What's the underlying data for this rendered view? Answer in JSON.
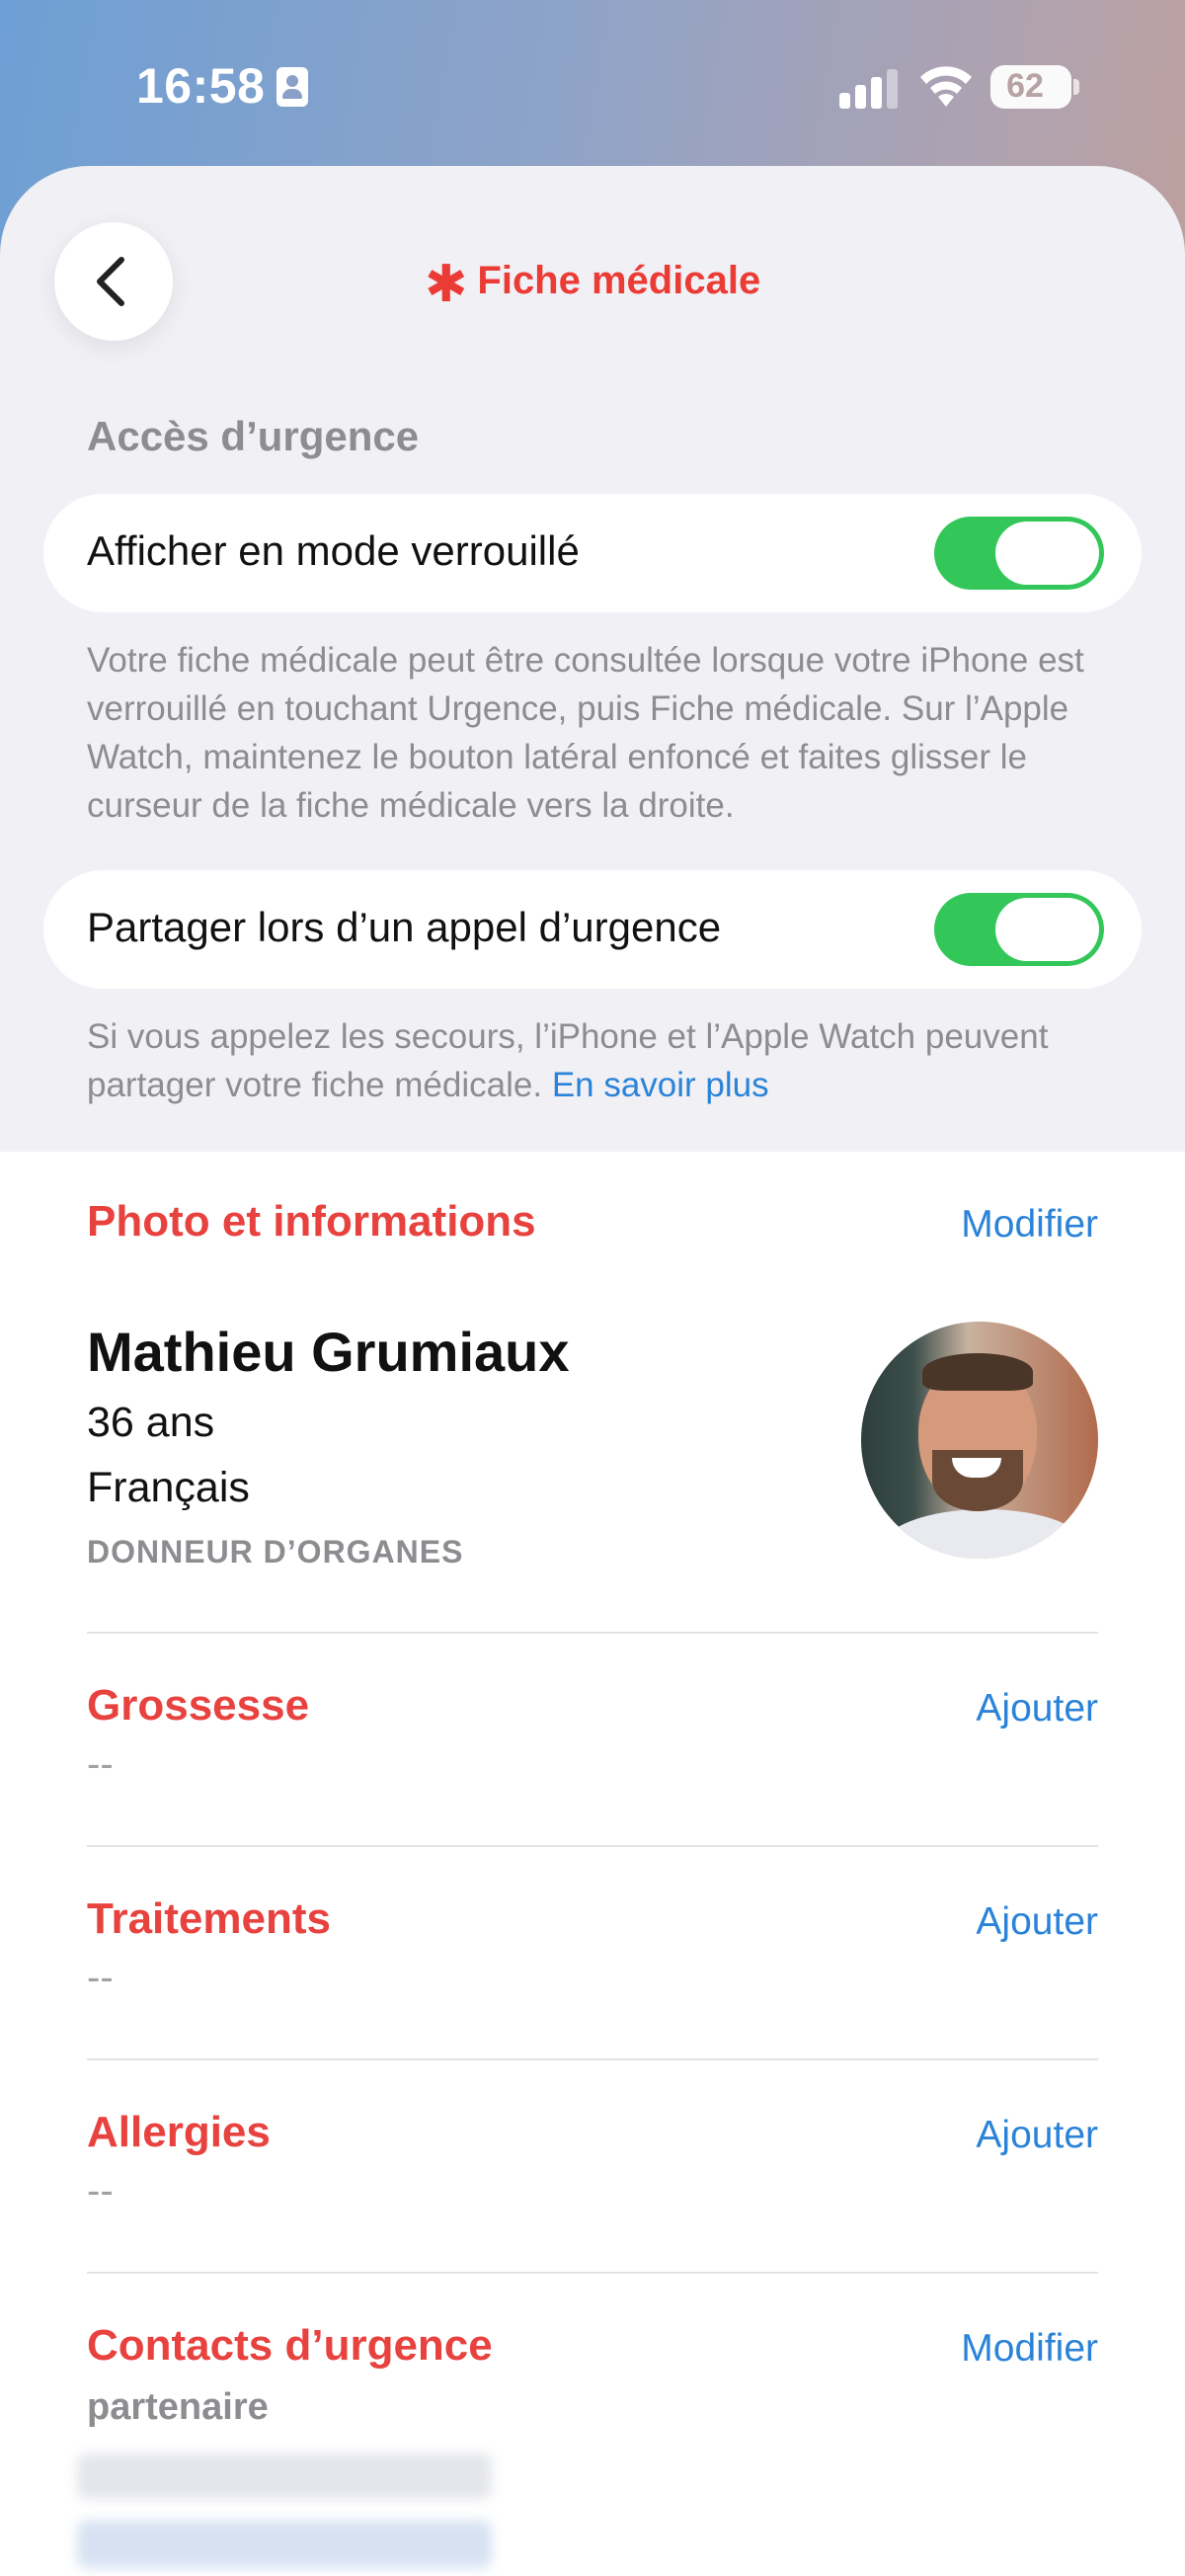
{
  "status_bar": {
    "time": "16:58",
    "battery": "62"
  },
  "nav": {
    "title": "Fiche médicale",
    "asterisk": "✱"
  },
  "emergency_access": {
    "header": "Accès d’urgence",
    "lock_screen": {
      "label": "Afficher en mode verrouillé",
      "enabled": true,
      "note": "Votre fiche médicale peut être consultée lorsque votre iPhone est verrouillé en touchant Urgence, puis Fiche médicale. Sur l’Apple Watch, maintenez le bouton latéral enfoncé et faites glisser le curseur de la fiche médicale vers la droite."
    },
    "share_call": {
      "label": "Partager lors d’un appel d’urgence",
      "enabled": true,
      "note": "Si vous appelez les secours, l’iPhone et l’Apple Watch peuvent partager votre fiche médicale.",
      "link": "En savoir plus"
    }
  },
  "profile": {
    "section_title": "Photo et informations",
    "action": "Modifier",
    "name": "Mathieu Grumiaux",
    "age": "36 ans",
    "language": "Français",
    "donor": "DONNEUR D’ORGANES"
  },
  "sections": {
    "pregnancy": {
      "title": "Grossesse",
      "action": "Ajouter",
      "value": "--"
    },
    "treatments": {
      "title": "Traitements",
      "action": "Ajouter",
      "value": "--"
    },
    "allergies": {
      "title": "Allergies",
      "action": "Ajouter",
      "value": "--"
    },
    "contacts": {
      "title": "Contacts d’urgence",
      "action": "Modifier",
      "relation": "partenaire"
    }
  },
  "colors": {
    "accent_red": "#e8423f",
    "link_blue": "#2a83d8",
    "toggle_green": "#33c759"
  }
}
